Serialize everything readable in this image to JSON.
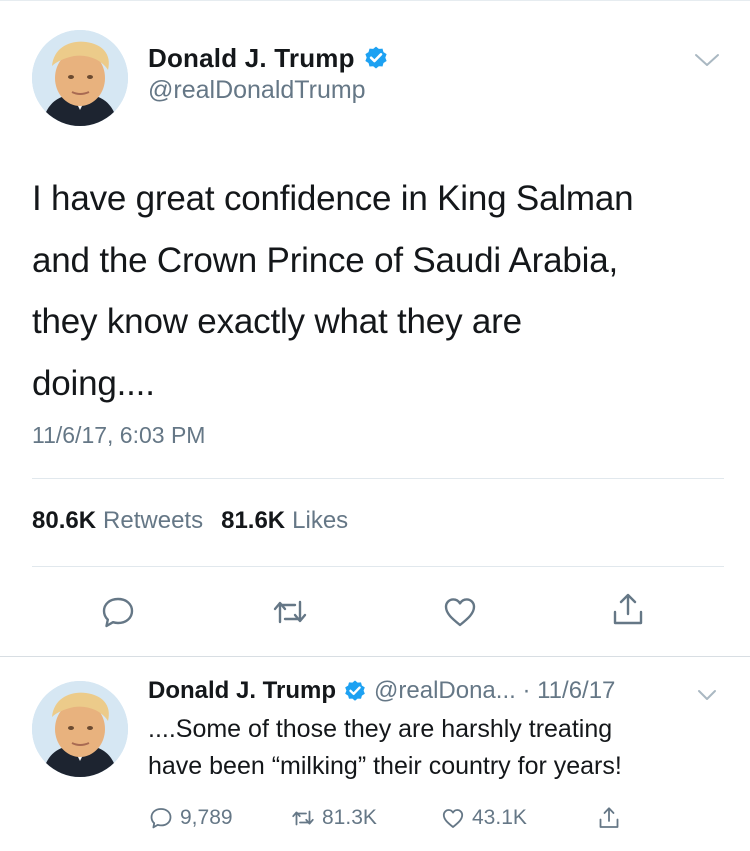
{
  "main_tweet": {
    "author_name": "Donald J. Trump",
    "handle": "@realDonaldTrump",
    "text_lines": [
      "I have great confidence in King Salman",
      "and the Crown Prince of Saudi Arabia,",
      "they know exactly what they are",
      "doing...."
    ],
    "timestamp": "11/6/17, 6:03 PM",
    "retweets_count": "80.6K",
    "retweets_label": "Retweets",
    "likes_count": "81.6K",
    "likes_label": "Likes"
  },
  "reply_tweet": {
    "author_name": "Donald J. Trump",
    "handle_and_date": "@realDona... · 11/6/17",
    "text_lines": [
      "....Some of those they are harshly treating",
      "have been “milking” their country for years!"
    ],
    "reply_count": "9,789",
    "retweet_count": "81.3K",
    "like_count": "43.1K"
  },
  "colors": {
    "verified_badge": "#1da1f2",
    "secondary_text": "#657786",
    "action_icon": "#657786",
    "divider": "#e1e8ed"
  },
  "icons": [
    "verified-badge-icon",
    "chevron-down-icon",
    "reply-icon",
    "retweet-icon",
    "like-icon",
    "share-icon"
  ]
}
